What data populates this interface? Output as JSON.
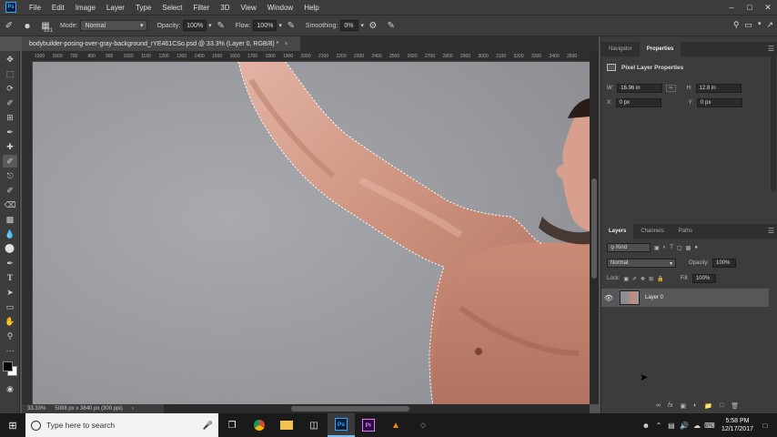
{
  "app": {
    "logo": "Ps",
    "menu": [
      "File",
      "Edit",
      "Image",
      "Layer",
      "Type",
      "Select",
      "Filter",
      "3D",
      "View",
      "Window",
      "Help"
    ],
    "window_controls": [
      "–",
      "□",
      "✕"
    ]
  },
  "options": {
    "brush_size": "121",
    "mode_label": "Mode:",
    "mode_value": "Normal",
    "opacity_label": "Opacity:",
    "opacity_value": "100%",
    "flow_label": "Flow:",
    "flow_value": "100%",
    "smoothing_label": "Smoothing:",
    "smoothing_value": "0%"
  },
  "document": {
    "tab_title": "bodybuilder-posing-over-gray-background_rYE461CSo.psd @ 33.3% (Layer 0, RGB/8) *",
    "close": "×",
    "zoom": "33.33%",
    "doc_info": "5088 px x 3840 px (300 ppi)",
    "ruler_ticks": [
      "1500",
      "1600",
      "700",
      "800",
      "900",
      "1000",
      "1100",
      "1200",
      "1300",
      "1400",
      "1500",
      "1600",
      "1700",
      "1800",
      "1900",
      "2000",
      "2100",
      "2200",
      "2300",
      "2400",
      "2500",
      "2600",
      "2700",
      "2800",
      "2900",
      "3000",
      "3100",
      "3200",
      "3300",
      "3400",
      "3500"
    ]
  },
  "properties": {
    "tabs": [
      "Navigator",
      "Properties"
    ],
    "title": "Pixel Layer Properties",
    "w_label": "W:",
    "w_value": "16.96 in",
    "h_label": "H:",
    "h_value": "12.8 in",
    "x_label": "X:",
    "x_value": "0 px",
    "y_label": "Y:",
    "y_value": "0 px"
  },
  "layers": {
    "tabs": [
      "Layers",
      "Channels",
      "Paths"
    ],
    "kind": "Kind",
    "blend_mode": "Normal",
    "opacity_label": "Opacity:",
    "opacity_value": "100%",
    "lock_label": "Lock:",
    "fill_label": "Fill:",
    "fill_value": "100%",
    "layer_name": "Layer 0"
  },
  "taskbar": {
    "search_placeholder": "Type here to search",
    "time": "5:58 PM",
    "date": "12/17/2017"
  }
}
